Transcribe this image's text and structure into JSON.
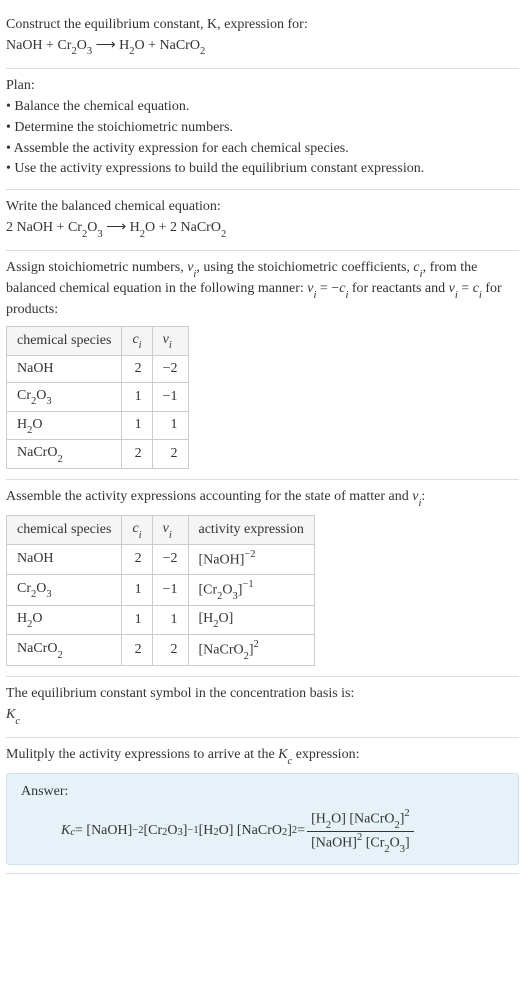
{
  "intro": {
    "prompt": "Construct the equilibrium constant, K, expression for:",
    "equation_lhs1": "NaOH + Cr",
    "equation_lhs1_sub": "2",
    "equation_lhs2": "O",
    "equation_lhs2_sub": "3",
    "arrow": "  ⟶  H",
    "equation_rhs1_sub": "2",
    "equation_rhs2": "O + NaCrO",
    "equation_rhs2_sub": "2"
  },
  "plan": {
    "heading": "Plan:",
    "b1": "• Balance the chemical equation.",
    "b2": "• Determine the stoichiometric numbers.",
    "b3": "• Assemble the activity expression for each chemical species.",
    "b4": "• Use the activity expressions to build the equilibrium constant expression."
  },
  "balanced": {
    "heading": "Write the balanced chemical equation:",
    "eq_a": "2 NaOH + Cr",
    "eq_b_sub": "2",
    "eq_c": "O",
    "eq_d_sub": "3",
    "eq_arrow": "  ⟶  H",
    "eq_e_sub": "2",
    "eq_f": "O + 2 NaCrO",
    "eq_g_sub": "2"
  },
  "stoich": {
    "para_a": "Assign stoichiometric numbers, ",
    "para_nu": "ν",
    "para_isub": "i",
    "para_b": ", using the stoichiometric coefficients, ",
    "para_c": "c",
    "para_c2": ", from the balanced chemical equation in the following manner: ",
    "rel1a": "ν",
    "rel1b": "i",
    "rel1c": " = −",
    "rel1d": "c",
    "rel1e": "i",
    "rel1f": " for reactants and ",
    "rel2a": "ν",
    "rel2b": "i",
    "rel2c": " = ",
    "rel2d": "c",
    "rel2e": "i",
    "rel2f": " for products:",
    "th_species": "chemical species",
    "th_ci": "c",
    "th_ci_sub": "i",
    "th_nu": "ν",
    "th_nu_sub": "i",
    "r1": {
      "s_a": "NaOH",
      "c": "2",
      "nu": "−2"
    },
    "r2": {
      "s_a": "Cr",
      "s_b": "2",
      "s_c": "O",
      "s_d": "3",
      "c": "1",
      "nu": "−1"
    },
    "r3": {
      "s_a": "H",
      "s_b": "2",
      "s_c": "O",
      "c": "1",
      "nu": "1"
    },
    "r4": {
      "s_a": "NaCrO",
      "s_b": "2",
      "c": "2",
      "nu": "2"
    }
  },
  "activity": {
    "heading_a": "Assemble the activity expressions accounting for the state of matter and ",
    "heading_nu": "ν",
    "heading_i": "i",
    "heading_colon": ":",
    "th_species": "chemical species",
    "th_ci": "c",
    "th_ci_sub": "i",
    "th_nu": "ν",
    "th_nu_sub": "i",
    "th_act": "activity expression",
    "r1": {
      "s_a": "NaOH",
      "c": "2",
      "nu": "−2",
      "ax_a": "[NaOH]",
      "ax_exp": "−2"
    },
    "r2": {
      "s_a": "Cr",
      "s_b": "2",
      "s_c": "O",
      "s_d": "3",
      "c": "1",
      "nu": "−1",
      "ax_a": "[Cr",
      "ax_b": "2",
      "ax_c": "O",
      "ax_d": "3",
      "ax_e": "]",
      "ax_exp": "−1"
    },
    "r3": {
      "s_a": "H",
      "s_b": "2",
      "s_c": "O",
      "c": "1",
      "nu": "1",
      "ax_a": "[H",
      "ax_b": "2",
      "ax_c": "O]"
    },
    "r4": {
      "s_a": "NaCrO",
      "s_b": "2",
      "c": "2",
      "nu": "2",
      "ax_a": "[NaCrO",
      "ax_b": "2",
      "ax_c": "]",
      "ax_exp": "2"
    }
  },
  "symbol": {
    "line": "The equilibrium constant symbol in the concentration basis is:",
    "K": "K",
    "c": "c"
  },
  "multiply": {
    "line_a": "Mulitply the activity expressions to arrive at the ",
    "K": "K",
    "c": "c",
    "line_b": " expression:"
  },
  "answer": {
    "label": "Answer:",
    "K": "K",
    "c": "c",
    "eq": " = [NaOH]",
    "e1": "−2",
    "t1": " [Cr",
    "s1": "2",
    "t2": "O",
    "s2": "3",
    "t3": "]",
    "e2": "−1",
    "t4": " [H",
    "s3": "2",
    "t5": "O] [NaCrO",
    "s4": "2",
    "t6": "]",
    "e3": "2",
    "eq2": " = ",
    "num_a": "[H",
    "num_b": "2",
    "num_c": "O] [NaCrO",
    "num_d": "2",
    "num_e": "]",
    "num_exp": "2",
    "den_a": "[NaOH]",
    "den_exp": "2",
    "den_b": " [Cr",
    "den_c": "2",
    "den_d": "O",
    "den_e": "3",
    "den_f": "]"
  }
}
